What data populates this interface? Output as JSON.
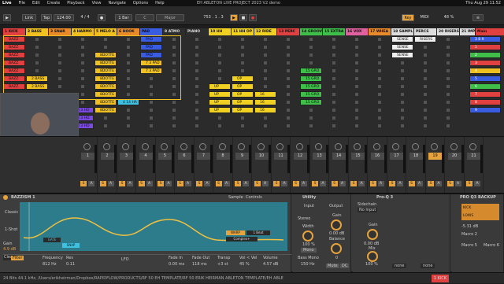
{
  "menubar": {
    "app": "Live",
    "items": [
      "File",
      "Edit",
      "Create",
      "Playback",
      "View",
      "Navigate",
      "Options",
      "Help"
    ],
    "title": "EH ABLETON LIVE PROJECT 2023 V2 demo",
    "clock": "Thu Aug 29 11:52"
  },
  "transport": {
    "link": "Link",
    "tap": "Tap",
    "tempo": "124.00",
    "sig": "4 / 4",
    "bar": "1 Bar",
    "key": "C",
    "scale": "Major",
    "position": "753 . 1 . 3",
    "key_btn": "Key",
    "midi": "MIDI",
    "cpu": "48 %"
  },
  "tracks": [
    {
      "label": "1 KICK",
      "color": "#e14040"
    },
    {
      "label": "2 BASS",
      "color": "#f0c020"
    },
    {
      "label": "3 SNAR",
      "color": "#e88a2a"
    },
    {
      "label": "4 HARMO",
      "color": "#f0c020"
    },
    {
      "label": "5 MELO A",
      "color": "#f0c020"
    },
    {
      "label": "6 HOOK",
      "color": "#e88a2a"
    },
    {
      "label": "PAD",
      "color": "#3a5ce0"
    },
    {
      "label": "8 ATMO",
      "color": "#2d2d2d"
    },
    {
      "label": "PIANO",
      "color": "#2d2d2d"
    },
    {
      "label": "10 HH",
      "color": "#f0d020"
    },
    {
      "label": "11 HH OP",
      "color": "#f0d020"
    },
    {
      "label": "12 RIDE",
      "color": "#f0d020"
    },
    {
      "label": "13 PERC",
      "color": "#e14040"
    },
    {
      "label": "14 GROOV",
      "color": "#3fbf4a"
    },
    {
      "label": "15 EXTRA",
      "color": "#3fbf4a"
    },
    {
      "label": "16 VOX",
      "color": "#e060a0"
    },
    {
      "label": "17 WHEA",
      "color": "#e88a2a"
    },
    {
      "label": "18 SAMPL",
      "color": "#dddddd"
    },
    {
      "label": "PERCS",
      "color": "#dddddd"
    },
    {
      "label": "20 RISERS",
      "color": "#dddddd"
    },
    {
      "label": "21 IMP",
      "color": "#dddddd"
    },
    {
      "label": "Main",
      "color": "#e14040"
    }
  ],
  "clips": [
    {
      "text": "BAZZ",
      "color": "#e14040"
    },
    {
      "text": "2 BASS",
      "color": "#f0c020"
    },
    {
      "text": "8DOTTE",
      "color": "#f0c020"
    },
    {
      "text": "PAD",
      "color": "#3a5ce0"
    },
    {
      "text": "7 3 PAD",
      "color": "#f0c020"
    },
    {
      "text": "8 3 HO",
      "color": "#7a4ae0"
    },
    {
      "text": "4 14 HA",
      "color": "#40c0e0"
    },
    {
      "text": "UP",
      "color": "#f0d020"
    },
    {
      "text": "OP",
      "color": "#f0d020"
    },
    {
      "text": "16",
      "color": "#f0d020"
    },
    {
      "text": "15 GRO",
      "color": "#3fbf4a"
    },
    {
      "text": "SENSE",
      "color": "#eeeeee"
    },
    {
      "text": "RISERS",
      "color": "#eeeeee"
    }
  ],
  "scenes": [
    "3 8 9",
    "1",
    "2",
    "3",
    "4",
    "5",
    "6",
    "7",
    "8",
    "9"
  ],
  "mixer": {
    "numbers": [
      "1",
      "2",
      "3",
      "4",
      "5",
      "6",
      "7",
      "8",
      "9",
      "10",
      "11",
      "12",
      "13",
      "14",
      "15",
      "16",
      "17",
      "18",
      "19",
      "20",
      "21"
    ]
  },
  "device": {
    "name": "BAZZISM 1",
    "sample_tab": "Sample",
    "controls_tab": "Controls",
    "mode": "Classic",
    "oneshot": "1-Shot",
    "gain_label": "Gain",
    "gain": "4.9 dB",
    "clean": "Clean",
    "filter": "Filter",
    "frequency_label": "Frequency",
    "frequency": "812 Hz",
    "res_label": "Res",
    "res": "0.11",
    "lfo": "LFO",
    "fade_in_label": "Fade In",
    "fade_in": "0.00 ms",
    "fade_out_label": "Fade Out",
    "fade_out": "118 ms",
    "transp_label": "Transp",
    "transp": "+3 st",
    "vol_vel_label": "Vol < Vel",
    "vol_vel": "45 %",
    "volume_label": "Volume",
    "volume": "4.57 dB",
    "warp": "WARP",
    "beat": "1 Beat",
    "complex": "Complex+"
  },
  "utility": {
    "name": "Utility",
    "input": "Input",
    "output": "Output",
    "stereo": "Stereo",
    "width_label": "Width",
    "width": "100 %",
    "mono": "Mono",
    "bass_mono": "Bass Mono",
    "bass_freq": "150 Hz",
    "gain_label": "Gain",
    "gain": "0.00 dB",
    "balance_label": "Balance",
    "balance": "0",
    "mute": "Mute",
    "dc": "DC"
  },
  "proq": {
    "name": "Pro-Q 3",
    "sidechain": "Sidechain",
    "no_input": "No Input",
    "gain_label": "Gain",
    "gain": "0.00 dB",
    "mix_label": "Mix",
    "mix": "100 %",
    "none1": "none",
    "none2": "none"
  },
  "rack": {
    "name": "PRO Q3 BACKUP",
    "kick": "KICK",
    "lows": "LOWS",
    "db": "-5.31 dB",
    "m2": "Macro 2",
    "m5": "Macro 5",
    "m6": "Macro 6"
  },
  "status": "24 Bits 44.1 kHz, /Users/erikheirman/Dropbox/RAPIDFLOW/PRODUCTS/RF 50 EH TEMPLATE/RF 50 ERIK HEIRMAN ABLETON TEMPLATE/EH ABLE",
  "status_right": "1 KICK",
  "colors": {
    "accent": "#e6a23c",
    "selection": "#f0c020"
  }
}
